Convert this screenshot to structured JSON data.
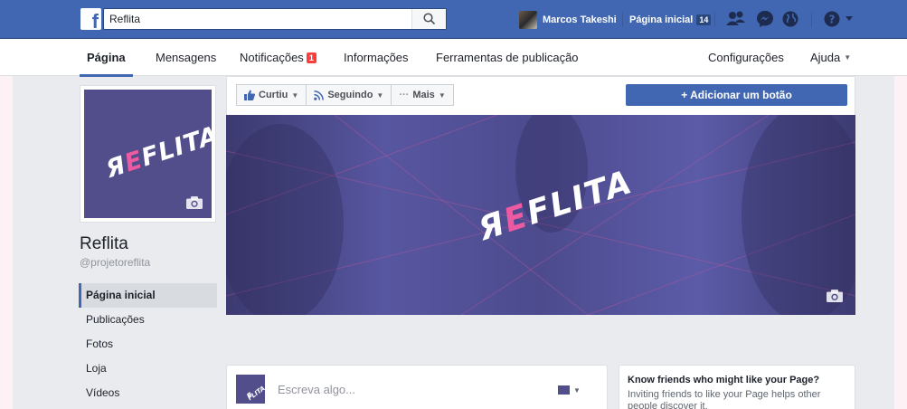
{
  "topbar": {
    "logo": "f",
    "search_value": "Reflita",
    "user_name": "Marcos Takeshi",
    "home_label": "Página inicial",
    "home_count": "14"
  },
  "tabs": {
    "pagina": "Página",
    "mensagens": "Mensagens",
    "notificacoes": "Notificações",
    "notificacoes_badge": "1",
    "informacoes": "Informações",
    "ferramentas": "Ferramentas de publicação",
    "configuracoes": "Configurações",
    "ajuda": "Ajuda"
  },
  "page": {
    "name": "Reflita",
    "handle": "@projetoreflita",
    "logo_text_prefix": "Я",
    "logo_text_pink": "E",
    "logo_text_rest": "FLITA"
  },
  "leftnav": {
    "items": [
      "Página inicial",
      "Publicações",
      "Fotos",
      "Loja",
      "Vídeos"
    ]
  },
  "cover": {
    "like_label": "Curtiu",
    "follow_label": "Seguindo",
    "more_label": "Mais",
    "add_button_label": "+ Adicionar um botão"
  },
  "composer": {
    "placeholder": "Escreva algo..."
  },
  "invite": {
    "title": "Know friends who might like your Page?",
    "text": "Inviting friends to like your Page helps other people discover it."
  },
  "colors": {
    "brand_blue": "#4267b2",
    "cover_purple": "#524e8c",
    "logo_pink": "#ee5aa1",
    "badge_red": "#fa3e3e"
  }
}
